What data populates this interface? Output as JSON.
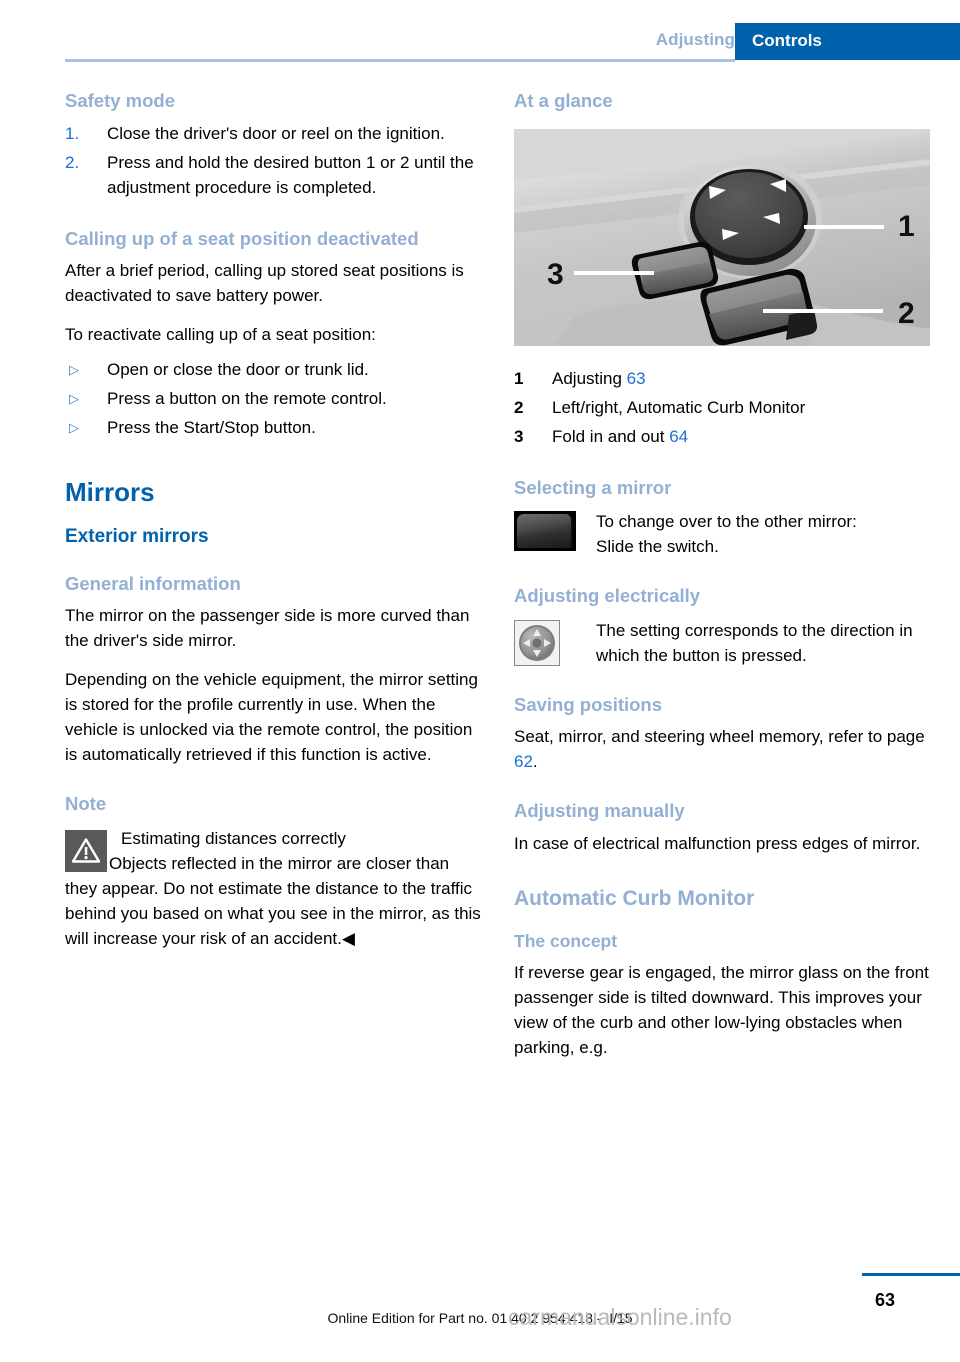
{
  "header": {
    "chapter": "Adjusting",
    "section": "Controls"
  },
  "left_column": {
    "safety_mode": {
      "heading": "Safety mode",
      "steps": [
        {
          "num": "1.",
          "text": "Close the driver's door or reel on the ignition."
        },
        {
          "num": "2.",
          "text": "Press and hold the desired button 1 or 2 until the adjustment procedure is completed."
        }
      ]
    },
    "calling_up": {
      "heading": "Calling up of a seat position deactivated",
      "para1": "After a brief period, calling up stored seat positions is deactivated to save battery power.",
      "para2": "To reactivate calling up of a seat position:",
      "bullets": [
        "Open or close the door or trunk lid.",
        "Press a button on the remote control.",
        "Press the Start/Stop button."
      ],
      "bullet_marker": "▷"
    },
    "mirrors": {
      "heading": "Mirrors",
      "subheading": "Exterior mirrors",
      "general_information": {
        "heading": "General information",
        "para1": "The mirror on the passenger side is more curved than the driver's side mirror.",
        "para2": "Depending on the vehicle equipment, the mirror setting is stored for the profile currently in use. When the vehicle is unlocked via the remote control, the position is automatically retrieved if this function is active."
      },
      "note": {
        "heading": "Note",
        "title": "Estimating distances correctly",
        "body": "Objects reflected in the mirror are closer than they appear. Do not estimate the distance to the traffic behind you based on what you see in the mirror, as this will increase your risk of an accident.",
        "end_marker": "◀"
      }
    }
  },
  "right_column": {
    "at_a_glance": {
      "heading": "At a glance",
      "illustration_labels": [
        "1",
        "2",
        "3"
      ],
      "legend": [
        {
          "num": "1",
          "label": "Adjusting",
          "page": "63"
        },
        {
          "num": "2",
          "label": "Left/right, Automatic Curb Monitor",
          "page": ""
        },
        {
          "num": "3",
          "label": "Fold in and out",
          "page": "64"
        }
      ]
    },
    "selecting_a_mirror": {
      "heading": "Selecting a mirror",
      "line1": "To change over to the other mirror:",
      "line2": "Slide the switch."
    },
    "adjusting_electrically": {
      "heading": "Adjusting electrically",
      "body": "The setting corresponds to the direction in which the button is pressed."
    },
    "saving_positions": {
      "heading": "Saving positions",
      "body_before": "Seat, mirror, and steering wheel memory, refer to page ",
      "page": "62",
      "body_after": "."
    },
    "adjusting_manually": {
      "heading": "Adjusting manually",
      "body": "In case of electrical malfunction press edges of mirror."
    },
    "automatic_curb_monitor": {
      "heading": "Automatic Curb Monitor",
      "subheading": "The concept",
      "body": "If reverse gear is engaged, the mirror glass on the front passenger side is tilted downward. This improves your view of the curb and other low-lying obstacles when parking, e.g."
    }
  },
  "footer": {
    "edition": "Online Edition for Part no. 01 40 2 954 418 - II/15",
    "page_number": "63",
    "watermark": "carmanualsonline.info"
  }
}
